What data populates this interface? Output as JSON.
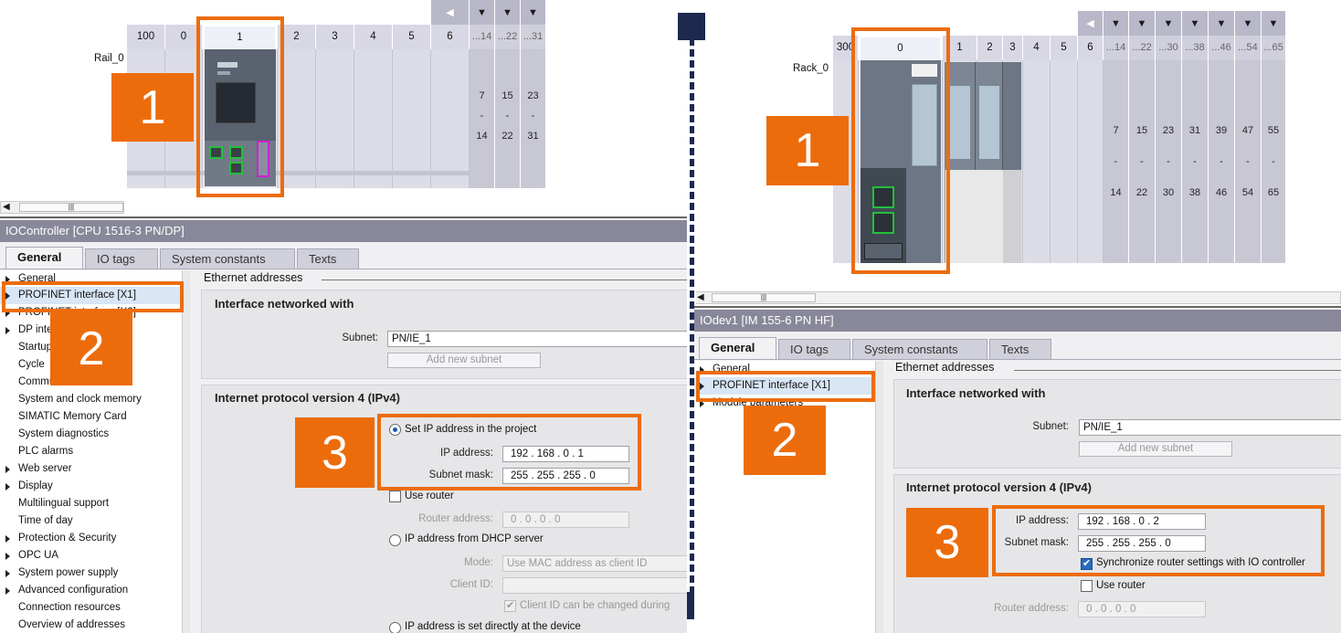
{
  "left_rack": {
    "rail_label": "Rail_0",
    "slots": [
      "100",
      "0",
      "1",
      "2",
      "3",
      "4",
      "5",
      "6"
    ],
    "range_headers": [
      "...14",
      "...22",
      "...31"
    ],
    "ranges": [
      [
        "7",
        "-",
        "14"
      ],
      [
        "15",
        "-",
        "22"
      ],
      [
        "23",
        "-",
        "31"
      ]
    ]
  },
  "right_rack": {
    "rack_label": "Rack_0",
    "slots": [
      "300",
      "0",
      "1",
      "2",
      "3",
      "4",
      "5",
      "6"
    ],
    "range_headers": [
      "...14",
      "...22",
      "...30",
      "...38",
      "...46",
      "...54",
      "...65"
    ],
    "ranges": [
      [
        "7",
        "-",
        "14"
      ],
      [
        "15",
        "-",
        "22"
      ],
      [
        "23",
        "-",
        "30"
      ],
      [
        "31",
        "-",
        "38"
      ],
      [
        "39",
        "-",
        "46"
      ],
      [
        "47",
        "-",
        "54"
      ],
      [
        "55",
        "-",
        "65"
      ]
    ]
  },
  "left_panel": {
    "title": "IOController [CPU 1516-3 PN/DP]",
    "tabs": [
      "General",
      "IO tags",
      "System constants",
      "Texts"
    ],
    "nav": [
      "General",
      "PROFINET interface [X1]",
      "PROFINET interface [X2]",
      "DP interface",
      "Startup",
      "Cycle",
      "Communication load",
      "System and clock memory",
      "SIMATIC Memory Card",
      "System diagnostics",
      "PLC alarms",
      "Web server",
      "Display",
      "Multilingual support",
      "Time of day",
      "Protection & Security",
      "OPC UA",
      "System power supply",
      "Advanced configuration",
      "Connection resources",
      "Overview of addresses"
    ],
    "section_header": "Ethernet addresses",
    "iface_title": "Interface networked with",
    "subnet_label": "Subnet:",
    "subnet_value": "PN/IE_1",
    "add_subnet": "Add new subnet",
    "ipv4_title": "Internet protocol version 4 (IPv4)",
    "set_ip_label": "Set IP address in the project",
    "ip_label": "IP address:",
    "ip_value": "192 . 168 . 0   . 1",
    "mask_label": "Subnet mask:",
    "mask_value": "255 . 255 . 255 . 0",
    "use_router": "Use router",
    "router_label": "Router address:",
    "router_value": "0   . 0   . 0   . 0",
    "dhcp_label": "IP address from DHCP server",
    "mode_label": "Mode:",
    "mode_value": "Use MAC address as client ID",
    "client_id_label": "Client ID:",
    "client_id_change": "Client ID can be changed during",
    "direct_label": "IP address is set directly at the device"
  },
  "right_panel": {
    "title": "IOdev1 [IM 155-6 PN HF]",
    "tabs": [
      "General",
      "IO tags",
      "System constants",
      "Texts"
    ],
    "nav": [
      "General",
      "PROFINET interface [X1]",
      "Module parameters"
    ],
    "section_header": "Ethernet addresses",
    "iface_title": "Interface networked with",
    "subnet_label": "Subnet:",
    "subnet_value": "PN/IE_1",
    "add_subnet": "Add new subnet",
    "ipv4_title": "Internet protocol version 4 (IPv4)",
    "ip_label": "IP address:",
    "ip_value": "192 . 168 . 0    . 2",
    "mask_label": "Subnet mask:",
    "mask_value": "255 . 255 . 255 . 0",
    "sync_label": "Synchronize router settings with IO controller",
    "use_router": "Use router",
    "router_label": "Router address:",
    "router_value": "0   . 0   . 0   . 0"
  },
  "callouts": {
    "one": "1",
    "two": "2",
    "three": "3"
  },
  "colors": {
    "accent": "#ec6c0c",
    "title_bar": "#88889a",
    "rack_bg": "#dcdce6",
    "port_green": "#22c03a",
    "port_magenta": "#d020d0"
  }
}
